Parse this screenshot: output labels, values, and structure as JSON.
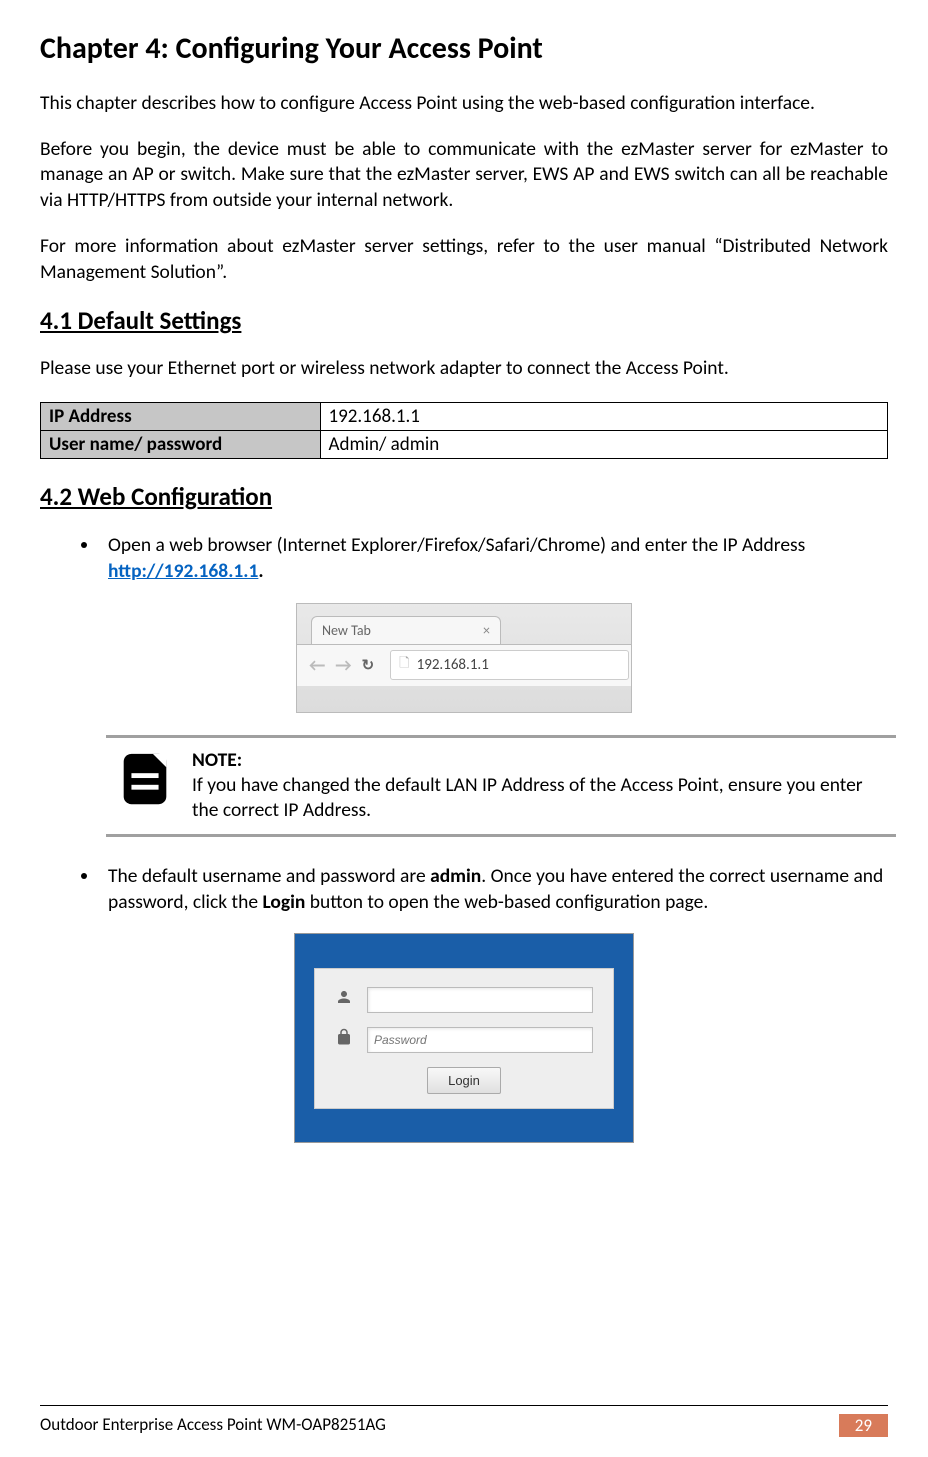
{
  "chapter_title": "Chapter 4: Configuring Your Access Point",
  "para1": "This chapter describes how to configure Access Point using the web-based configuration interface.",
  "para2": "Before you begin, the device must be able to communicate with the ezMaster server for ezMaster to manage an AP or switch. Make sure that the ezMaster server, EWS AP and EWS switch can all be reachable via HTTP/HTTPS from outside your internal network.",
  "para3": "For more information about ezMaster server settings, refer to the user manual “Distributed Network Management Solution”.",
  "section_41": "4.1 Default Settings",
  "section_41_text": "Please use your Ethernet port or wireless network adapter to connect the Access Point.",
  "settings_table": {
    "row1": {
      "label": "IP Address",
      "value": "192.168.1.1"
    },
    "row2": {
      "label": "User name/ password",
      "value": "Admin/ admin"
    }
  },
  "section_42": "4.2 Web Configuration",
  "bullet1_prefix": "Open a web browser (Internet Explorer/Firefox/Safari/Chrome) and enter the IP Address ",
  "bullet1_link": "http://192.168.1.1",
  "bullet1_suffix": ".",
  "browser": {
    "tab_label": "New Tab",
    "url_text": "192.168.1.1"
  },
  "note": {
    "title": "NOTE:",
    "text": "If you have changed the default LAN IP Address of the Access Point, ensure you enter the correct IP Address."
  },
  "bullet2_p1": "The default username and password are ",
  "bullet2_b1": "admin",
  "bullet2_p2": ". Once you have entered the correct username and password, click the ",
  "bullet2_b2": "Login",
  "bullet2_p3": " button to open the web-based configuration page.",
  "login": {
    "password_placeholder": "Password",
    "button_label": "Login"
  },
  "footer": {
    "left": "Outdoor Enterprise Access Point WM-OAP8251AG",
    "page": "29"
  }
}
